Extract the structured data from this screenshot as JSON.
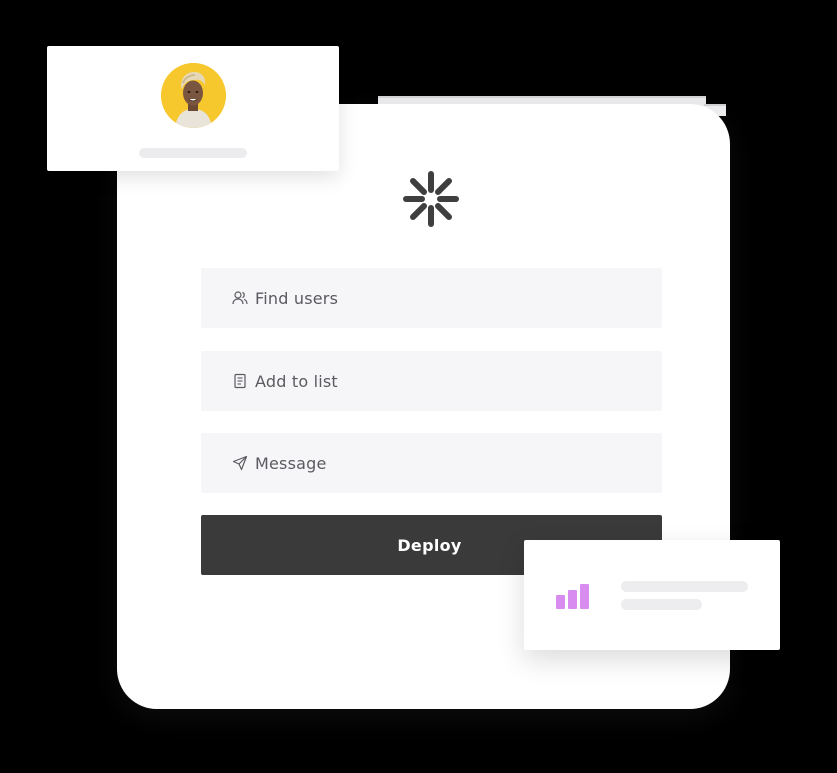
{
  "form": {
    "fields": [
      {
        "label": "Find users",
        "icon": "users-icon"
      },
      {
        "label": "Add to list",
        "icon": "document-list-icon"
      },
      {
        "label": "Message",
        "icon": "send-icon"
      }
    ],
    "deploy_label": "Deploy"
  },
  "brand": {
    "icon": "asterisk-logo-icon"
  },
  "colors": {
    "background": "#000000",
    "card": "#ffffff",
    "field": "#f6f6f8",
    "button": "#3a3a3a",
    "avatar_bg": "#f7c72e",
    "chart_accent": "#d98cf0",
    "placeholder_line": "#ececee"
  },
  "profile_card": {
    "avatar": "avatar-photo"
  },
  "stats_card": {
    "icon": "bar-chart-icon"
  }
}
